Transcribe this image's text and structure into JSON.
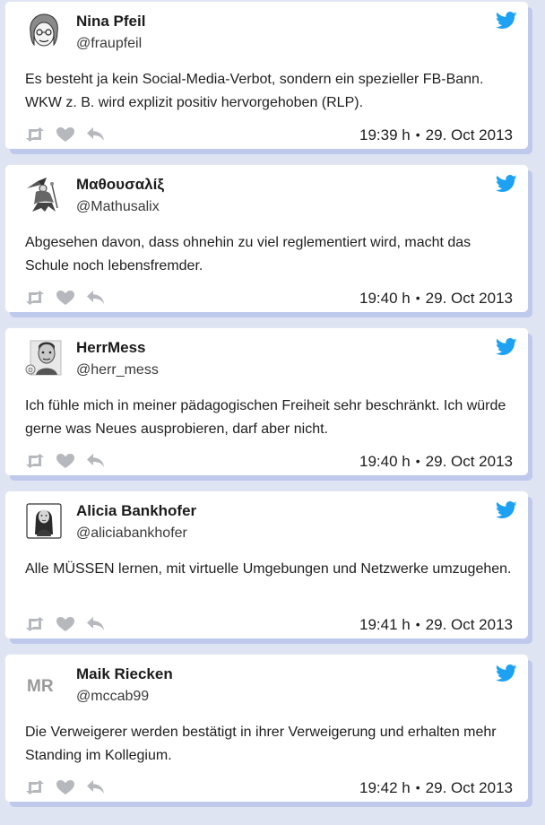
{
  "colors": {
    "twitter_blue": "#1da1f2",
    "action_gray": "#b5b8bd",
    "card_shadow": "#bfc9ec"
  },
  "tweets": [
    {
      "name": "Nina Pfeil",
      "handle": "@fraupfeil",
      "text": "Es besteht ja kein Social-Media-Verbot, sondern ein spezieller FB-Bann. WKW z. B. wird explizit positiv hervorgehoben (RLP).",
      "time": "19:39 h",
      "separator": "•",
      "date": "29. Oct 2013",
      "avatar_icon": "cartoon-face-avatar"
    },
    {
      "name": "Μαθουσαλίξ",
      "handle": "@Mathusalix",
      "text": "Abgesehen davon, dass ohnehin zu viel reglementiert wird, macht das Schule noch lebensfremder.",
      "time": "19:40 h",
      "separator": "•",
      "date": "29. Oct 2013",
      "avatar_icon": "wizard-figure-avatar"
    },
    {
      "name": "HerrMess",
      "handle": "@herr_mess",
      "text": "Ich fühle mich in meiner pädagogischen Freiheit sehr beschränkt. Ich würde gerne was Neues ausprobieren, darf aber nicht.",
      "time": "19:40 h",
      "separator": "•",
      "date": "29. Oct 2013",
      "avatar_icon": "caricature-portrait-avatar"
    },
    {
      "name": "Alicia Bankhofer",
      "handle": "@aliciabankhofer",
      "text": "Alle MÜSSEN lernen, mit virtuelle Umgebungen und Netzwerke umzugehen.",
      "time": "19:41 h",
      "separator": "•",
      "date": "29. Oct 2013",
      "avatar_icon": "photo-portrait-avatar"
    },
    {
      "name": "Maik Riecken",
      "handle": "@mccab99",
      "text": "Die Verweigerer werden bestätigt in ihrer Verweigerung und erhalten mehr Standing im Kollegium.",
      "time": "19:42 h",
      "separator": "•",
      "date": "29. Oct 2013",
      "avatar_icon": "mr-logo-avatar",
      "avatar_logo_text": "MR"
    }
  ],
  "actions": {
    "retweet_icon": "retweet-icon",
    "like_icon": "heart-icon",
    "reply_icon": "reply-icon",
    "brand_icon": "twitter-bird-icon"
  }
}
